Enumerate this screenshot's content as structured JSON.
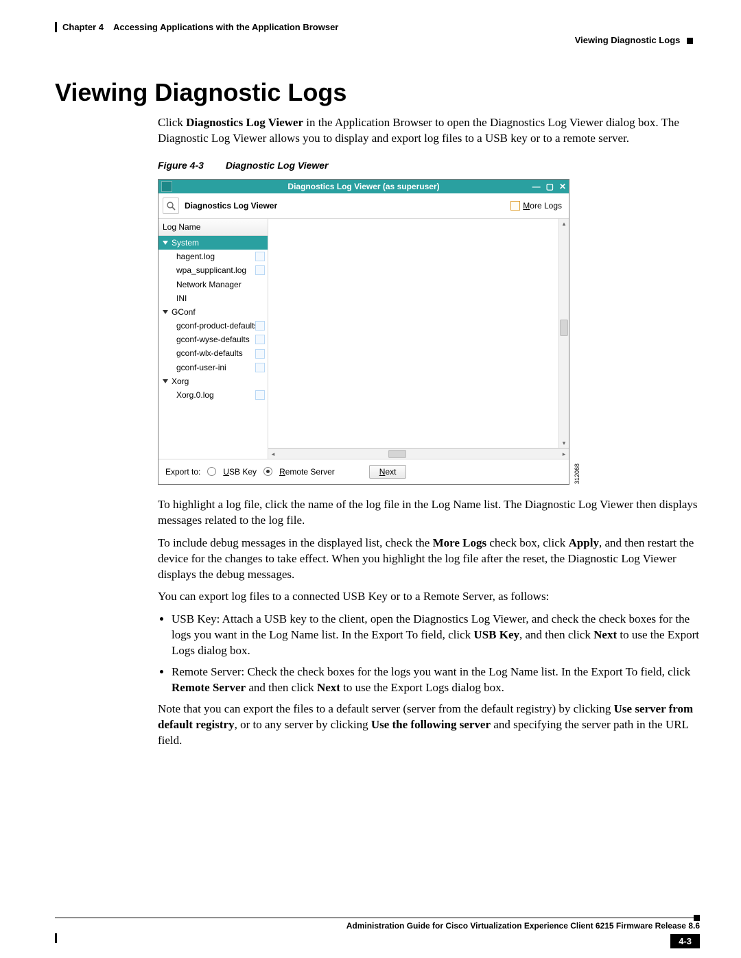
{
  "header": {
    "chapter_label": "Chapter 4",
    "chapter_title": "Accessing Applications with the Application Browser",
    "section_title": "Viewing Diagnostic Logs"
  },
  "title": "Viewing Diagnostic Logs",
  "intro": {
    "p1_a": "Click ",
    "p1_b": "Diagnostics Log Viewer",
    "p1_c": " in the Application Browser to open the Diagnostics Log Viewer dialog box. The Diagnostic Log Viewer allows you to display and export log files to a USB key or to a remote server."
  },
  "figure": {
    "num": "Figure 4-3",
    "caption": "Diagnostic Log Viewer"
  },
  "dialog": {
    "title": "Diagnostics Log Viewer (as superuser)",
    "app_label": "Diagnostics Log Viewer",
    "more_logs": "More Logs",
    "more_logs_u": "M",
    "tree_header": "Log Name",
    "groups": {
      "system": "System",
      "network_manager": "Network Manager",
      "ini": "INI",
      "gconf": "GConf",
      "xorg": "Xorg"
    },
    "items": {
      "hagent": "hagent.log",
      "wpa": "wpa_supplicant.log",
      "gconf_product": "gconf-product-defaults",
      "gconf_wyse": "gconf-wyse-defaults",
      "gconf_wlx": "gconf-wlx-defaults",
      "gconf_user": "gconf-user-ini",
      "xorg0": "Xorg.0.log"
    },
    "export_label": "Export to:",
    "usb_key": "USB Key",
    "usb_key_u": "U",
    "remote_server": "Remote Server",
    "remote_server_u": "R",
    "next": "Next",
    "next_u": "N",
    "image_id": "312068"
  },
  "after": {
    "p1": "To highlight a log file, click the name of the log file in the Log Name list. The Diagnostic Log Viewer then displays messages related to the log file.",
    "p2_a": "To include debug messages in the displayed list, check the ",
    "p2_b": "More Logs",
    "p2_c": " check box, click ",
    "p2_d": "Apply",
    "p2_e": ", and then restart the device for the changes to take effect. When you highlight the log file after the reset, the Diagnostic Log Viewer displays the debug messages.",
    "p3": "You can export log files to a connected USB Key or to a Remote Server, as follows:",
    "li1_a": "USB Key: Attach a USB key to the client, open the Diagnostics Log Viewer, and check the check boxes for the logs you want in the Log Name list. In the Export To field, click ",
    "li1_b": "USB Key",
    "li1_c": ", and then click ",
    "li1_d": "Next",
    "li1_e": " to use the Export Logs dialog box.",
    "li2_a": "Remote Server: Check the check boxes for the logs you want in the Log Name list. In the Export To field, click ",
    "li2_b": "Remote Server",
    "li2_c": " and then click ",
    "li2_d": "Next",
    "li2_e": " to use the Export Logs dialog box.",
    "p4_a": "Note that you can export the files to a default server (server from the default registry) by clicking ",
    "p4_b": "Use server from default registry",
    "p4_c": ", or to any server by clicking ",
    "p4_d": "Use the following server",
    "p4_e": " and specifying the server path in the URL field."
  },
  "footer": {
    "guide": "Administration Guide for Cisco Virtualization Experience Client 6215 Firmware Release 8.6",
    "page": "4-3"
  }
}
